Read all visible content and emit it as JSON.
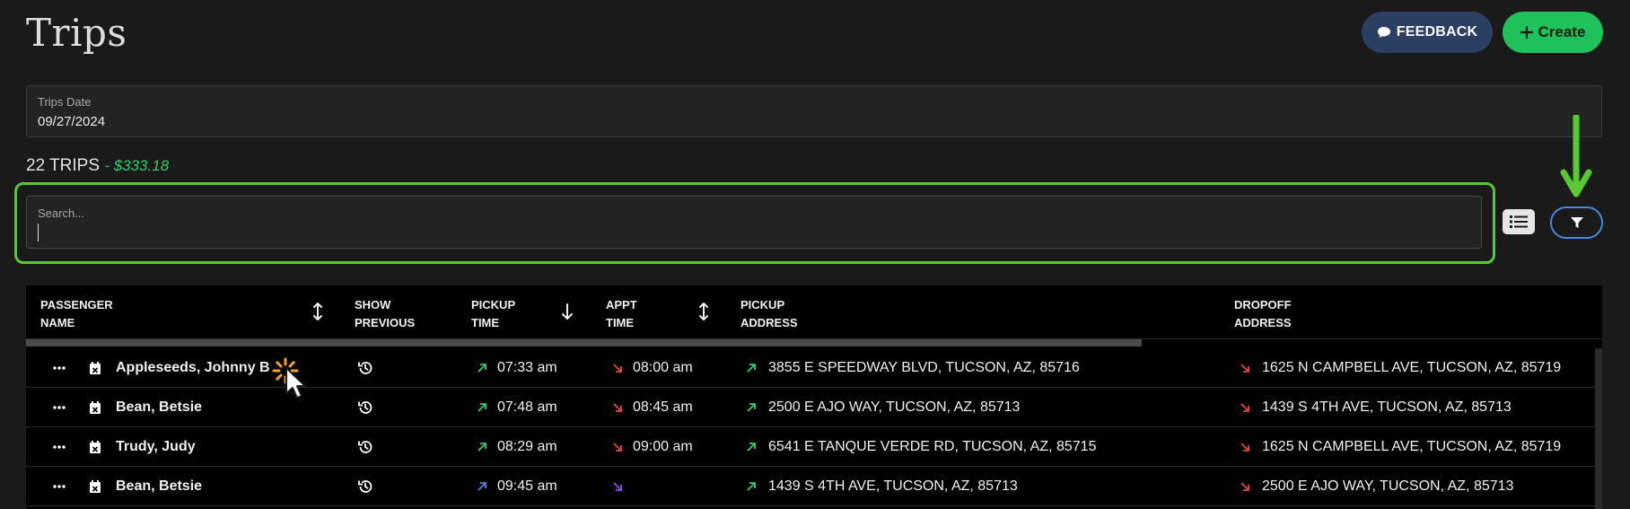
{
  "header": {
    "title": "Trips",
    "feedback_label": "FEEDBACK",
    "create_label": "Create"
  },
  "date_filter": {
    "label": "Trips Date",
    "value": "09/27/2024"
  },
  "summary": {
    "count_text": "22 TRIPS",
    "total_text": "- $333.18"
  },
  "search": {
    "placeholder": "Search..."
  },
  "table": {
    "columns": [
      {
        "line1": "PASSENGER",
        "line2": "NAME"
      },
      {
        "line1": "SHOW",
        "line2": "PREVIOUS"
      },
      {
        "line1": "PICKUP",
        "line2": "TIME"
      },
      {
        "line1": "APPT",
        "line2": "TIME"
      },
      {
        "line1": "PICKUP",
        "line2": "ADDRESS"
      },
      {
        "line1": "DROPOFF",
        "line2": "ADDRESS"
      }
    ],
    "rows": [
      {
        "name": "Appleseeds, Johnny B",
        "pickup_time": "07:33 am",
        "appt_time": "08:00 am",
        "pickup_address": "3855 E SPEEDWAY BLVD, TUCSON, AZ, 85716",
        "dropoff_address": "1625 N CAMPBELL AVE, TUCSON, AZ, 85719"
      },
      {
        "name": "Bean, Betsie",
        "pickup_time": "07:48 am",
        "appt_time": "08:45 am",
        "pickup_address": "2500 E AJO WAY, TUCSON, AZ, 85713",
        "dropoff_address": "1439 S 4TH AVE, TUCSON, AZ, 85713"
      },
      {
        "name": "Trudy, Judy",
        "pickup_time": "08:29 am",
        "appt_time": "09:00 am",
        "pickup_address": "6541 E TANQUE VERDE RD, TUCSON, AZ, 85715",
        "dropoff_address": "1625 N CAMPBELL AVE, TUCSON, AZ, 85719"
      },
      {
        "name": "Bean, Betsie",
        "pickup_time": "09:45 am",
        "appt_time": "",
        "pickup_address": "1439 S 4TH AVE, TUCSON, AZ, 85713",
        "dropoff_address": "2500 E AJO WAY, TUCSON, AZ, 85713"
      }
    ]
  },
  "colors": {
    "create_green": "#1fc25a",
    "feedback_navy": "#2b3f63",
    "highlight_green": "#5ac832",
    "filter_blue": "#4a86e0",
    "pickup_arrow_green": "#2fd06a",
    "appt_arrow_red": "#e8453c",
    "pickup_arrow_blue": "#4a86e0",
    "appt_arrow_purple": "#8b4cf0"
  },
  "icons": {
    "feedback": "speech-bubble-icon",
    "create": "plus-icon",
    "list_view": "list-icon",
    "filter": "funnel-icon",
    "row_menu": "ellipsis-icon",
    "row_cancel": "calendar-x-icon",
    "show_previous": "history-icon",
    "pickup": "arrow-up-right-icon",
    "dropoff": "arrow-down-right-icon",
    "sort_both": "sort-both-icon",
    "sort_down": "sort-down-icon",
    "loading": "spinner-icon",
    "pointer": "mouse-cursor-icon",
    "annotation": "green-arrow-down-icon"
  }
}
